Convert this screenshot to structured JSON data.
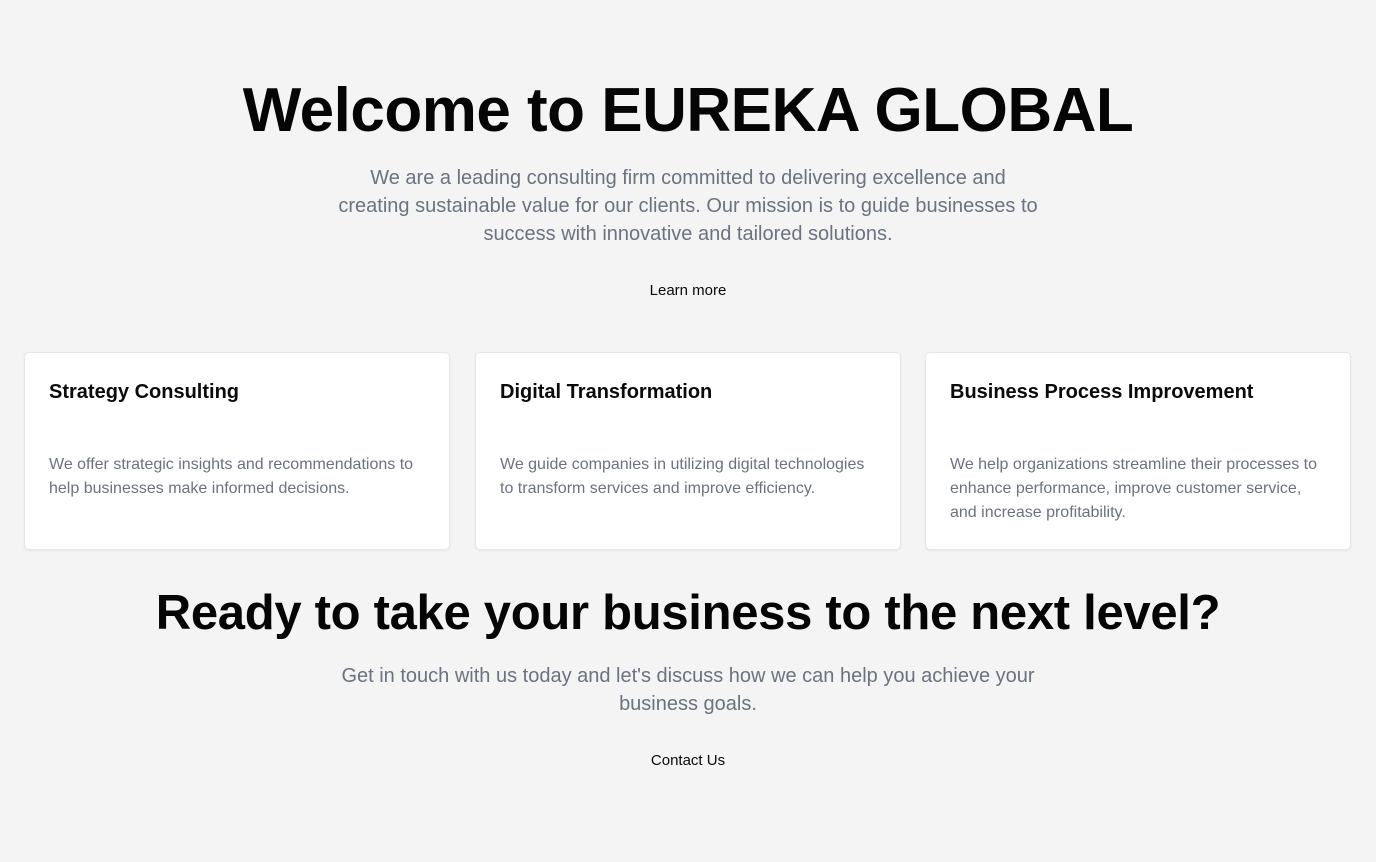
{
  "hero": {
    "title": "Welcome to EUREKA GLOBAL",
    "description": "We are a leading consulting firm committed to delivering excellence and creating sustainable value for our clients. Our mission is to guide businesses to success with innovative and tailored solutions.",
    "button_label": "Learn more"
  },
  "services": [
    {
      "title": "Strategy Consulting",
      "description": "We offer strategic insights and recommendations to help businesses make informed decisions."
    },
    {
      "title": "Digital Transformation",
      "description": "We guide companies in utilizing digital technologies to transform services and improve efficiency."
    },
    {
      "title": "Business Process Improvement",
      "description": "We help organizations streamline their processes to enhance performance, improve customer service, and increase profitability."
    }
  ],
  "cta": {
    "title": "Ready to take your business to the next level?",
    "description": "Get in touch with us today and let's discuss how we can help you achieve your business goals.",
    "button_label": "Contact Us"
  },
  "colors": {
    "background": "#f4f4f4",
    "card_background": "#ffffff",
    "heading": "#050505",
    "body_text": "#6b7280"
  }
}
